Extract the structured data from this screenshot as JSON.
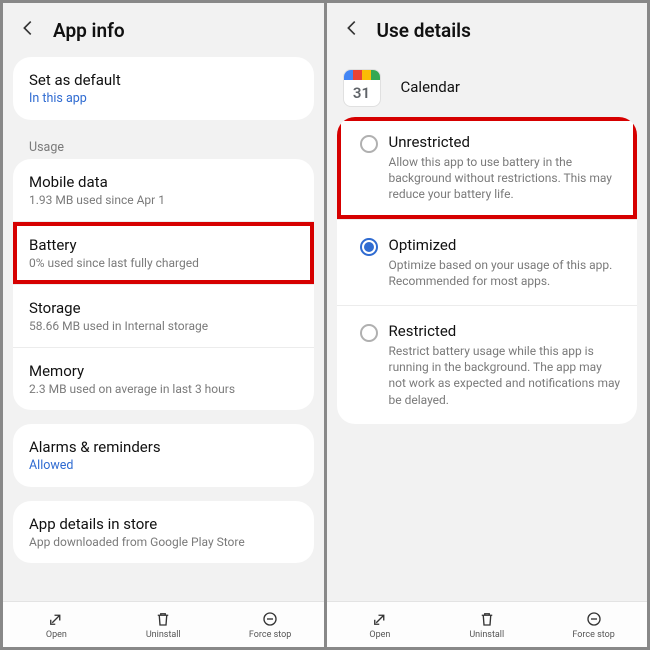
{
  "left": {
    "title": "App info",
    "set_default": {
      "title": "Set as default",
      "sub": "In this app"
    },
    "usage_label": "Usage",
    "mobile_data": {
      "title": "Mobile data",
      "sub": "1.93 MB used since Apr 1"
    },
    "battery": {
      "title": "Battery",
      "sub": "0% used since last fully charged"
    },
    "storage": {
      "title": "Storage",
      "sub": "58.66 MB used in Internal storage"
    },
    "memory": {
      "title": "Memory",
      "sub": "2.3 MB used on average in last 3 hours"
    },
    "alarms": {
      "title": "Alarms & reminders",
      "sub": "Allowed"
    },
    "store": {
      "title": "App details in store",
      "sub": "App downloaded from Google Play Store"
    }
  },
  "right": {
    "title": "Use details",
    "app_name": "Calendar",
    "cal_day": "31",
    "unrestricted": {
      "title": "Unrestricted",
      "sub": "Allow this app to use battery in the background without restrictions. This may reduce your battery life."
    },
    "optimized": {
      "title": "Optimized",
      "sub": "Optimize based on your usage of this app. Recommended for most apps."
    },
    "restricted": {
      "title": "Restricted",
      "sub": "Restrict battery usage while this app is running in the background. The app may not work as expected and notifications may be delayed."
    }
  },
  "bottom": {
    "open": "Open",
    "uninstall": "Uninstall",
    "force": "Force stop"
  }
}
